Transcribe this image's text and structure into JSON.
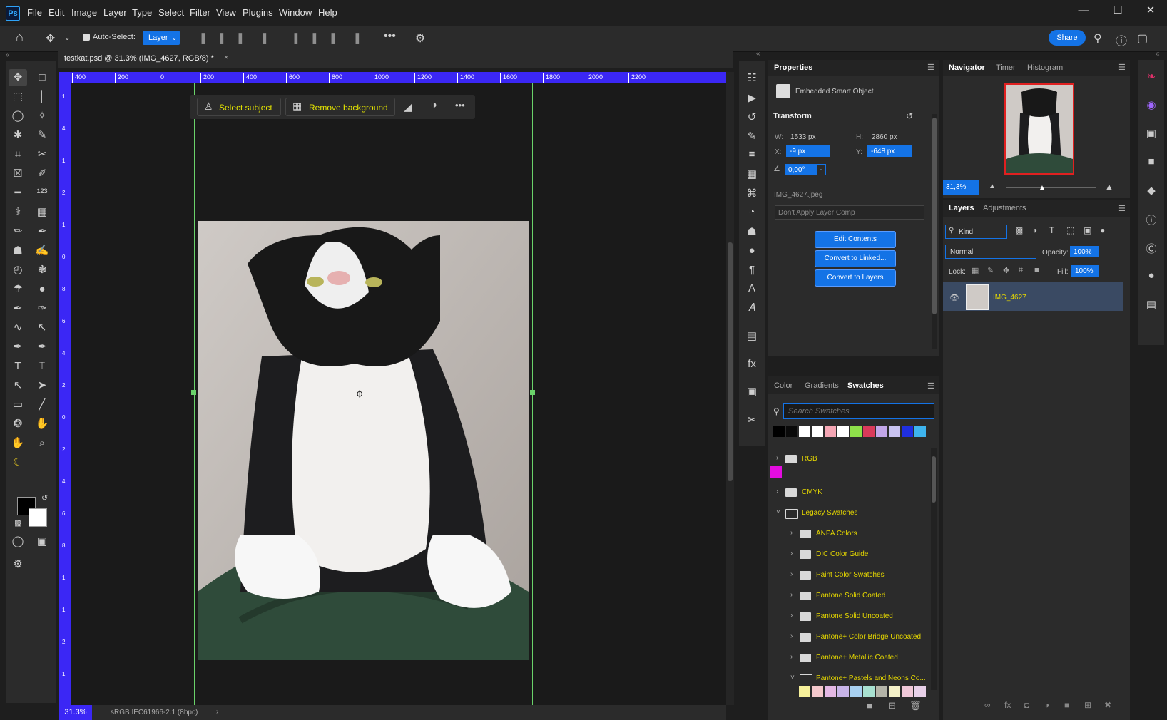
{
  "app": {
    "logo": "Ps"
  },
  "menu": [
    "File",
    "Edit",
    "Image",
    "Layer",
    "Type",
    "Select",
    "Filter",
    "View",
    "Plugins",
    "Window",
    "Help"
  ],
  "options": {
    "auto_select_label": "Auto-Select:",
    "auto_select_value": "Layer",
    "share_label": "Share"
  },
  "document": {
    "tab_title": "testkat.psd @ 31.3% (IMG_4627, RGB/8) *",
    "ruler_h": [
      "400",
      "200",
      "0",
      "200",
      "400",
      "600",
      "800",
      "1000",
      "1200",
      "1400",
      "1600",
      "1800",
      "2000",
      "2200"
    ],
    "ruler_v": [
      "1",
      "4",
      "1",
      "2",
      "1",
      "0",
      "8",
      "6",
      "4",
      "2",
      "0",
      "2",
      "4",
      "6",
      "8",
      "1",
      "1",
      "2",
      "1"
    ],
    "zoom": "31.3%",
    "color_profile": "sRGB IEC61966-2.1 (8bpc)"
  },
  "contextual_taskbar": {
    "select_subject": "Select subject",
    "remove_background": "Remove background"
  },
  "properties": {
    "tab": "Properties",
    "type": "Embedded Smart Object",
    "transform_heading": "Transform",
    "w_label": "W:",
    "w_value": "1533 px",
    "h_label": "H:",
    "h_value": "2860 px",
    "x_label": "X:",
    "x_value": "-9 px",
    "y_label": "Y:",
    "y_value": "-648 px",
    "angle_value": "0,00°",
    "filename": "IMG_4627.jpeg",
    "layer_comp": "Don't Apply Layer Comp",
    "buttons": [
      "Edit Contents",
      "Convert to Linked...",
      "Convert to Layers"
    ]
  },
  "swatches": {
    "tabs": [
      "Color",
      "Gradients",
      "Swatches"
    ],
    "active_tab": "Swatches",
    "search_placeholder": "Search Swatches",
    "recent_colors": [
      "#000000",
      "#0a0a0a",
      "#ffffff",
      "#ffffff",
      "#f4a6b4",
      "#ffffff",
      "#8ee04a",
      "#d93a5a",
      "#c2a6e8",
      "#c9c3f0",
      "#1f2fe0",
      "#3eb4ee"
    ],
    "groups": [
      {
        "name": "RGB",
        "level": 0,
        "open": false
      },
      {
        "name": "CMYK",
        "level": 0,
        "open": false
      },
      {
        "name": "Legacy Swatches",
        "level": 0,
        "open": true
      },
      {
        "name": "ANPA Colors",
        "level": 1,
        "open": false
      },
      {
        "name": "DIC Color Guide",
        "level": 1,
        "open": false
      },
      {
        "name": "Paint Color Swatches",
        "level": 1,
        "open": false
      },
      {
        "name": "Pantone Solid Coated",
        "level": 1,
        "open": false
      },
      {
        "name": "Pantone Solid Uncoated",
        "level": 1,
        "open": false
      },
      {
        "name": "Pantone+ Color Bridge Uncoated",
        "level": 1,
        "open": false
      },
      {
        "name": "Pantone+ Metallic Coated",
        "level": 1,
        "open": false
      },
      {
        "name": "Pantone+ Pastels and Neons Co...",
        "level": 1,
        "open": true
      }
    ],
    "single_swatch": "#e40ce0",
    "pastel_colors": [
      "#f6f09a",
      "#f4c8cc",
      "#e4b8e4",
      "#c8b4e8",
      "#a8d0f0",
      "#a8e0d0",
      "#b4b4a8",
      "#f4f0c8",
      "#f0c8d8",
      "#e8d0e8"
    ]
  },
  "navigator": {
    "tabs": [
      "Navigator",
      "Timer",
      "Histogram"
    ],
    "active_tab": "Navigator",
    "zoom": "31,3%"
  },
  "layers": {
    "tabs": [
      "Layers",
      "Adjustments"
    ],
    "active_tab": "Layers",
    "filter": "Kind",
    "blend_mode": "Normal",
    "opacity_label": "Opacity:",
    "opacity": "100%",
    "lock_label": "Lock:",
    "fill_label": "Fill:",
    "fill": "100%",
    "items": [
      {
        "name": "IMG_4627",
        "visible": true
      }
    ]
  }
}
